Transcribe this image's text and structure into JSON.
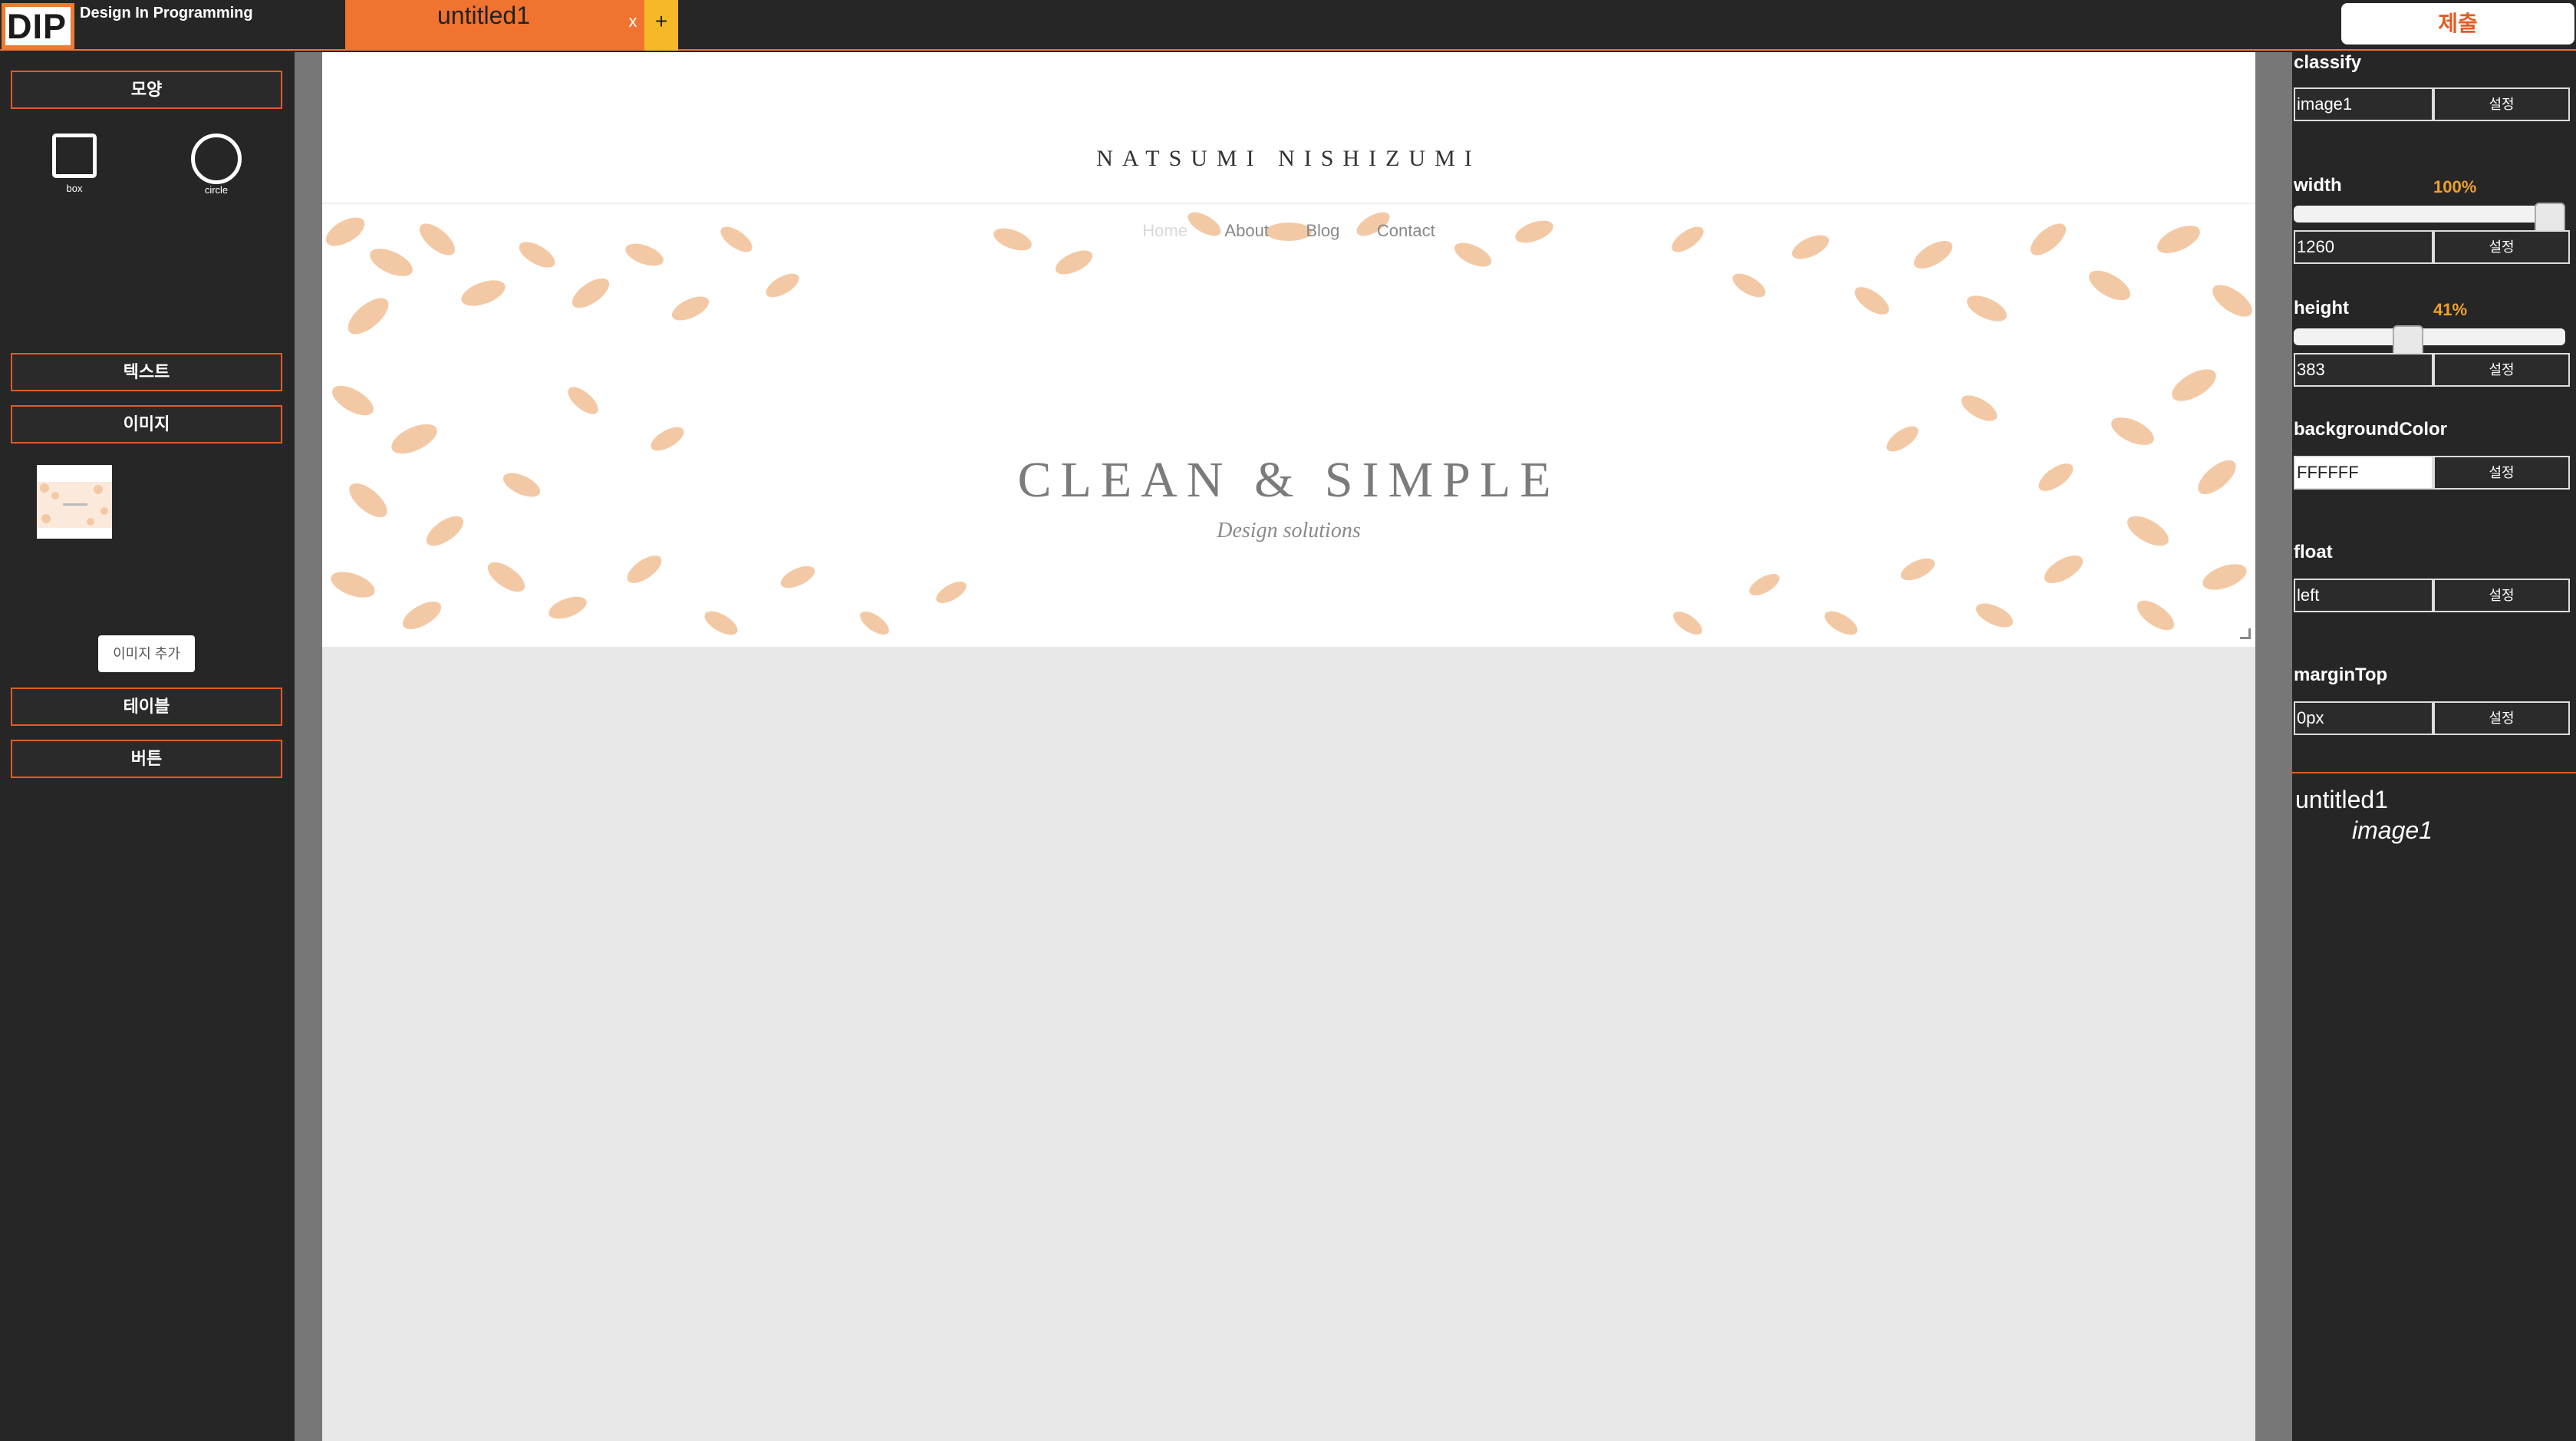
{
  "app": {
    "logo_text": "DIP",
    "name": "Design In Programming",
    "tab_title": "untitled1",
    "tab_close": "x",
    "tab_add": "+",
    "submit_label": "제출",
    "accent_color": "#f07330"
  },
  "left_panel": {
    "shape_section": "모양",
    "shapes": [
      {
        "label": "box",
        "icon": "square-icon"
      },
      {
        "label": "circle",
        "icon": "circle-icon"
      }
    ],
    "text_section": "텍스트",
    "image_section": "이미지",
    "add_image_label": "이미지 추가",
    "table_section": "테이블",
    "button_section": "버튼"
  },
  "canvas": {
    "site_name": "NATSUMI NISHIZUMI",
    "nav": [
      "Home",
      "About",
      "Blog",
      "Contact"
    ],
    "hero_title": "CLEAN & SIMPLE",
    "hero_subtitle": "Design solutions"
  },
  "properties": {
    "classify": {
      "label": "classify",
      "value": "image1",
      "button": "설정"
    },
    "width": {
      "label": "width",
      "percent_label": "100%",
      "percent": 1.0,
      "value": "1260",
      "button": "설정"
    },
    "height": {
      "label": "height",
      "percent_label": "41%",
      "percent": 0.41,
      "value": "383",
      "button": "설정"
    },
    "backgroundColor": {
      "label": "backgroundColor",
      "value": "FFFFFF",
      "button": "설정"
    },
    "float": {
      "label": "float",
      "value": "left",
      "button": "설정"
    },
    "marginTop": {
      "label": "marginTop",
      "value": "0px",
      "button": "설정"
    }
  },
  "tree": {
    "root": "untitled1",
    "child": "image1"
  }
}
